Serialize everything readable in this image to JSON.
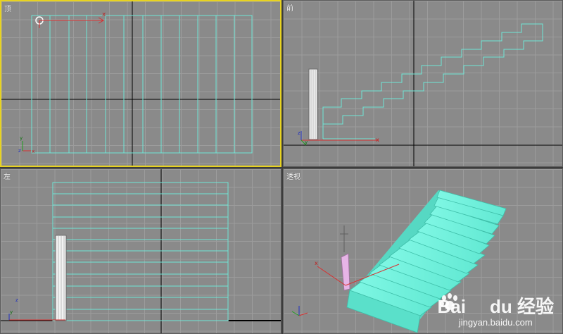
{
  "viewports": {
    "top": {
      "label": "顶"
    },
    "front": {
      "label": "前"
    },
    "left": {
      "label": "左"
    },
    "perspective": {
      "label": "透视"
    }
  },
  "axes": {
    "x": "x",
    "y": "y",
    "z": "z"
  },
  "watermark": {
    "brand_latin": "Bai",
    "brand_du": "du",
    "brand_cn": "经验",
    "url": "jingyan.baidu.com"
  },
  "colors": {
    "viewport_bg": "#8a8a8a",
    "grid": "#9c9c9c",
    "wireframe": "#6fe6d6",
    "active_border": "#e8d320",
    "stair_fill": "#6ff2dc",
    "figure": "#e6b4e6"
  }
}
